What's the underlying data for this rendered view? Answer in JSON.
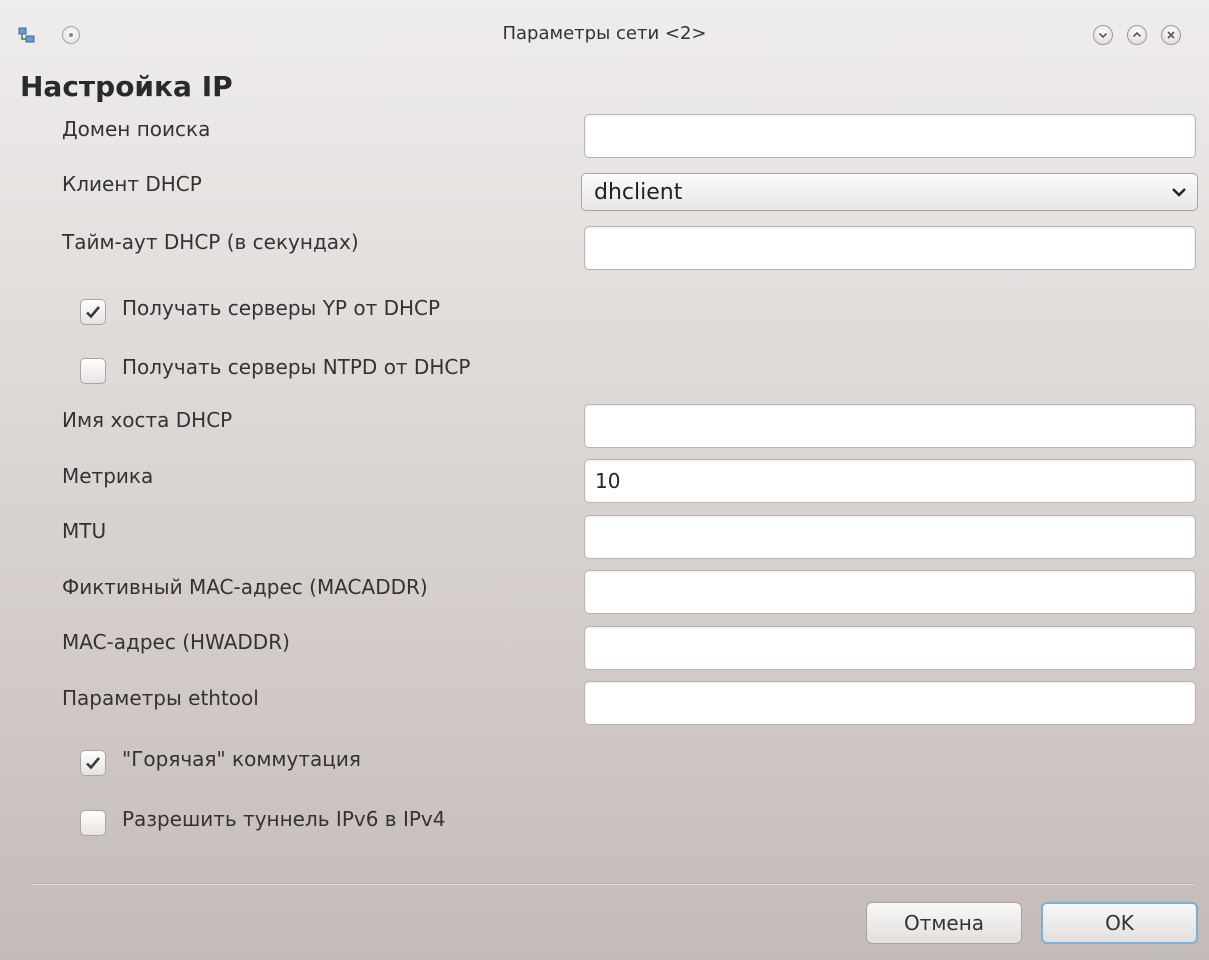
{
  "window": {
    "title": "Параметры сети <2>",
    "buttons": [
      "minimize-icon",
      "maximize-icon",
      "close-icon"
    ]
  },
  "section_title": "Настройка IP",
  "fields": {
    "search_domain": {
      "label": "Домен поиска",
      "value": ""
    },
    "dhcp_client": {
      "label": "Клиент DHCP",
      "value": "dhclient"
    },
    "dhcp_timeout": {
      "label": "Тайм-аут DHCP (в секундах)",
      "value": ""
    },
    "dhcp_hostname": {
      "label": "Имя хоста DHCP",
      "value": ""
    },
    "metric": {
      "label": "Метрика",
      "value": "10"
    },
    "mtu": {
      "label": "MTU",
      "value": ""
    },
    "fake_mac": {
      "label": "Фиктивный MAC-адрес (MACADDR)",
      "value": ""
    },
    "hw_mac": {
      "label": "MAC-адрес (HWADDR)",
      "value": ""
    },
    "ethtool": {
      "label": "Параметры ethtool",
      "value": ""
    }
  },
  "checkboxes": {
    "yp_servers": {
      "label": "Получать серверы YP от DHCP",
      "checked": true
    },
    "ntpd_servers": {
      "label": "Получать серверы NTPD от DHCP",
      "checked": false
    },
    "hotplug": {
      "label": "\"Горячая\" коммутация",
      "checked": true
    },
    "ipv6_tunnel": {
      "label": "Разрешить туннель IPv6 в IPv4",
      "checked": false
    }
  },
  "buttons": {
    "cancel": "Отмена",
    "ok": "OK"
  },
  "colors": {
    "accent": "#7aaede",
    "check": "#3a3a3a"
  }
}
